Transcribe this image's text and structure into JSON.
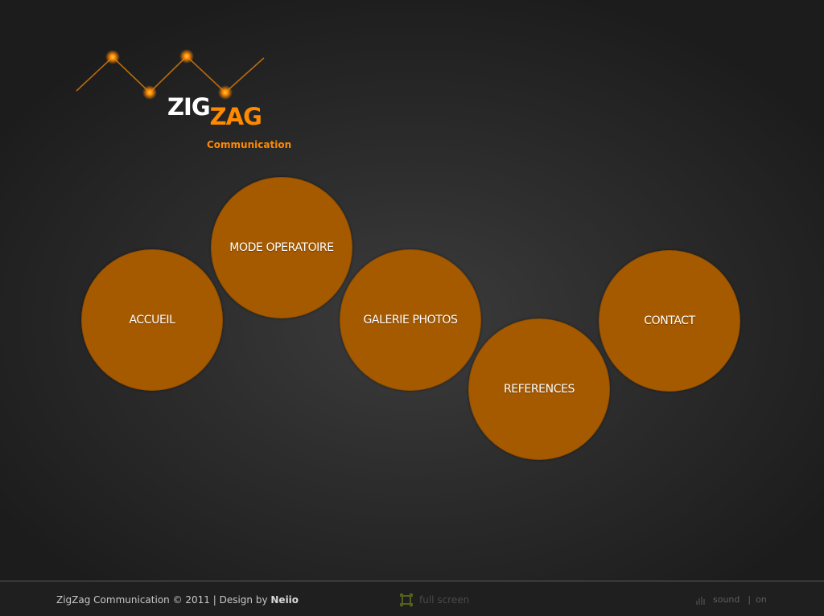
{
  "brand": {
    "zig": "ZIG",
    "zag": "ZAG",
    "tagline": "Communication"
  },
  "nav": {
    "accueil": "ACCUEIL",
    "mode_operatoire": "MODE OPERATOIRE",
    "galerie_photos": "GALERIE PHOTOS",
    "references": "REFERENCES",
    "contact": "CONTACT"
  },
  "footer": {
    "copyright": "ZigZag Communication © 2011 | Design by ",
    "designer": "Neiio",
    "fullscreen_label": "full screen",
    "sound_label": "sound",
    "sound_separator": "|",
    "sound_state": "on"
  },
  "colors": {
    "accent": "#ff8a00",
    "bubble": "#a65a00",
    "background": "#2d2d2d"
  },
  "icons": {
    "fullscreen": "fullscreen-icon",
    "sound": "sound-bars-icon"
  }
}
